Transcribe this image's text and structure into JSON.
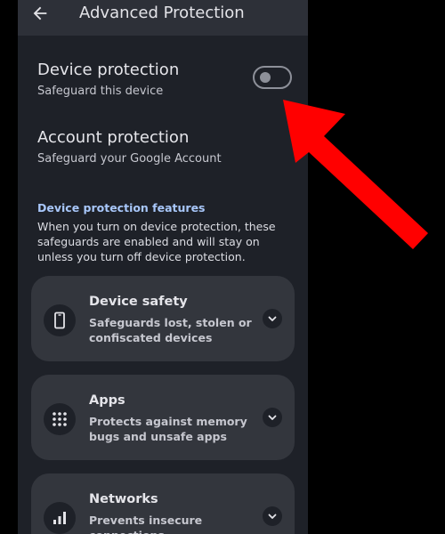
{
  "app_bar": {
    "title": "Advanced Protection",
    "back_icon": "arrow-back-icon"
  },
  "device_protection": {
    "title": "Device protection",
    "subtitle": "Safeguard this device",
    "toggle_on": false
  },
  "account_protection": {
    "title": "Account protection",
    "subtitle": "Safeguard your Google Account"
  },
  "features": {
    "header": "Device protection features",
    "description": "When you turn on device protection, these safeguards are enabled and will stay on unless you turn off device protection."
  },
  "cards": [
    {
      "title": "Device safety",
      "description": "Safeguards lost, stolen or confiscated devices",
      "icon": "phone-icon"
    },
    {
      "title": "Apps",
      "description": "Protects against memory bugs and unsafe apps",
      "icon": "apps-grid-icon"
    },
    {
      "title": "Networks",
      "description": "Prevents insecure connections",
      "icon": "signal-bars-icon"
    }
  ],
  "colors": {
    "background": "#1e2128",
    "app_bar": "#2d3038",
    "card": "#33363d",
    "accent": "#a8c7fa",
    "annotation_arrow": "#ff0000"
  }
}
